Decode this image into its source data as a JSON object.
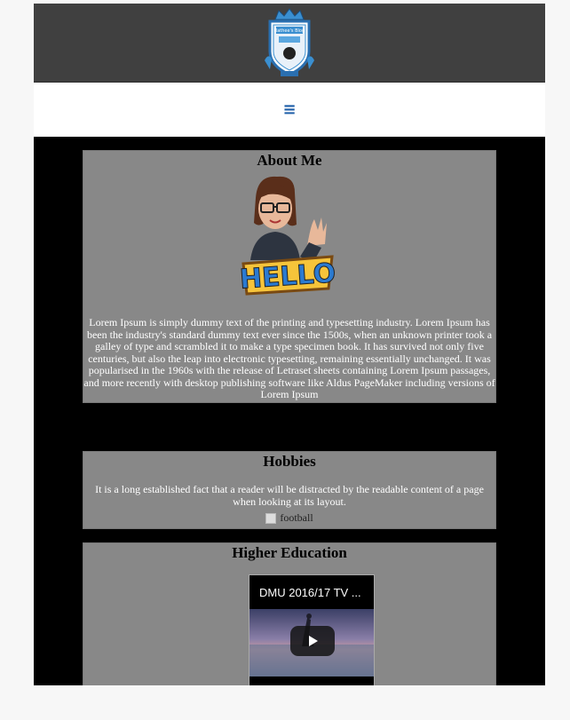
{
  "header": {
    "logo_icon": "club-crest-logo",
    "logo_banner_text": "Rathee's Blog"
  },
  "nav": {
    "menu_icon": "hamburger-menu-icon",
    "menu_glyph": "≡"
  },
  "about": {
    "title": "About Me",
    "image_icon": "bitmoji-hello-image",
    "text": "Lorem Ipsum is simply dummy text of the printing and typesetting industry. Lorem Ipsum has been the industry's standard dummy text ever since the 1500s, when an unknown printer took a galley of type and scrambled it to make a type specimen book. It has survived not only five centuries, but also the leap into electronic typesetting, remaining essentially unchanged. It was popularised in the 1960s with the release of Letraset sheets containing Lorem Ipsum passages, and more recently with desktop publishing software like Aldus PageMaker including versions of Lorem Ipsum"
  },
  "hobbies": {
    "title": "Hobbies",
    "text": "It is a long established fact that a reader will be distracted by the readable content of a page when looking at its layout.",
    "image_alt": "football"
  },
  "education": {
    "title": "Higher Education",
    "video_title": "DMU 2016/17 TV ...",
    "play_icon": "play-icon"
  },
  "colors": {
    "header_bg": "#404040",
    "page_bg": "#000000",
    "card_bg": "#888888",
    "menu_accent": "#1e5ea8"
  }
}
